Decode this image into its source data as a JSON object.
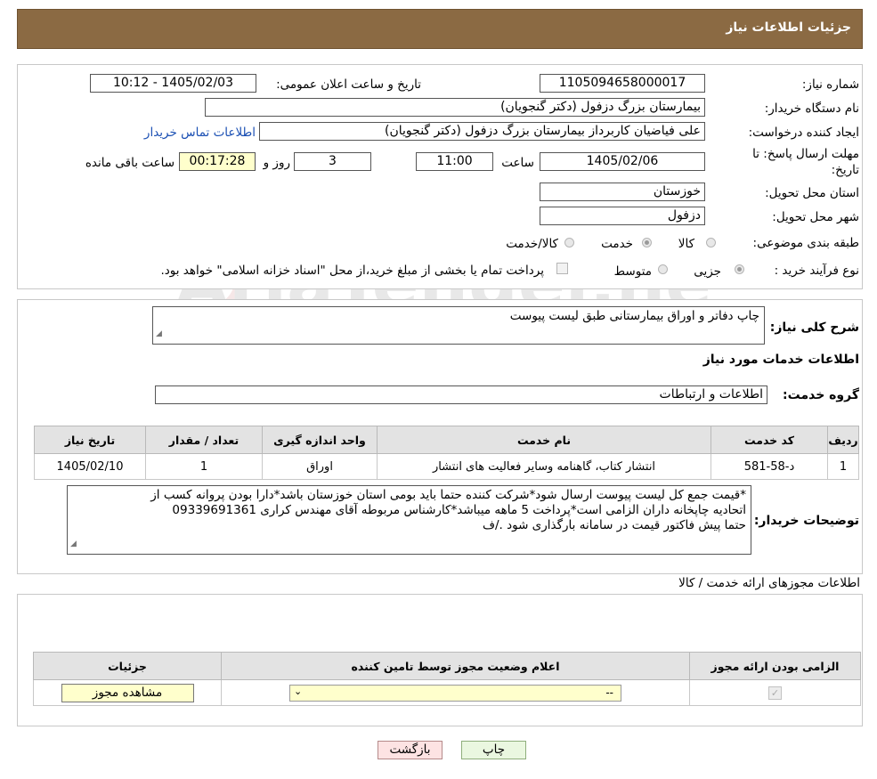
{
  "header": {
    "title": "جزئیات اطلاعات نیاز"
  },
  "need": {
    "number_label": "شماره نیاز:",
    "number_value": "1105094658000017",
    "announce_label": "تاریخ و ساعت اعلان عمومی:",
    "announce_value": "1405/02/03 - 10:12",
    "buyer_org_label": "نام دستگاه خریدار:",
    "buyer_org_value": "بیمارستان بزرگ دزفول (دکتر گنجویان)",
    "creator_label": "ایجاد کننده درخواست:",
    "creator_value": "علی فیاضیان کاربرداز بیمارستان بزرگ دزفول (دکتر گنجویان)",
    "contact_link": "اطلاعات تماس خریدار",
    "deadline_label_1": "مهلت ارسال پاسخ: تا",
    "deadline_label_2": "تاریخ:",
    "deadline_date": "1405/02/06",
    "time_label": "ساعت",
    "deadline_time": "11:00",
    "days_value": "3",
    "days_label": "روز و",
    "remaining_value": "00:17:28",
    "remaining_label": "ساعت باقی مانده",
    "province_label": "استان محل تحویل:",
    "province_value": "خوزستان",
    "city_label": "شهر محل تحویل:",
    "city_value": "دزفول",
    "category_label": "طبقه بندی موضوعی:",
    "category_options": [
      "کالا",
      "خدمت",
      "کالا/خدمت"
    ],
    "category_selected": "خدمت",
    "process_label": "نوع فرآیند خرید :",
    "process_options": [
      "جزیی",
      "متوسط"
    ],
    "process_selected": "جزیی",
    "process_note": "پرداخت تمام یا بخشی از مبلغ خرید،از محل \"اسناد خزانه اسلامی\" خواهد بود."
  },
  "summary": {
    "label": "شرح کلی نیاز:",
    "value": "چاپ دفاتر و اوراق بیمارستانی طبق لیست پیوست",
    "services_heading": "اطلاعات خدمات مورد نیاز",
    "group_label": "گروه خدمت:",
    "group_value": "اطلاعات و ارتباطات"
  },
  "services_table": {
    "headers": [
      "ردیف",
      "کد خدمت",
      "نام خدمت",
      "واحد اندازه گیری",
      "تعداد / مقدار",
      "تاریخ نیاز"
    ],
    "rows": [
      [
        "1",
        "د-58-581",
        "انتشار کتاب، گاهنامه وسایر فعالیت های انتشار",
        "اوراق",
        "1",
        "1405/02/10"
      ]
    ]
  },
  "buyer_notes": {
    "label": "توضیحات خریدار:",
    "lines": [
      "*قیمت جمع کل لیست پیوست ارسال شود*شرکت کننده حتما باید بومی استان خوزستان باشد*دارا بودن پروانه کسب از",
      "اتحادیه چاپخانه داران الزامی است*پرداخت 5 ماهه میباشد*کارشناس مربوطه آقای مهندس کراری 09339691361",
      "حتما پیش فاکتور قیمت در سامانه بارگذاری شود ./ف"
    ]
  },
  "permits": {
    "heading": "اطلاعات مجوزهای ارائه خدمت / کالا",
    "headers": [
      "الزامی بودن ارائه مجوز",
      "اعلام وضعیت مجوز توسط تامین کننده",
      "جزئیات"
    ],
    "select_value": "--",
    "view_button": "مشاهده مجوز"
  },
  "footer": {
    "print_button": "چاپ",
    "back_button": "بازگشت"
  },
  "watermark": {
    "text": "AriaTender.neT"
  }
}
